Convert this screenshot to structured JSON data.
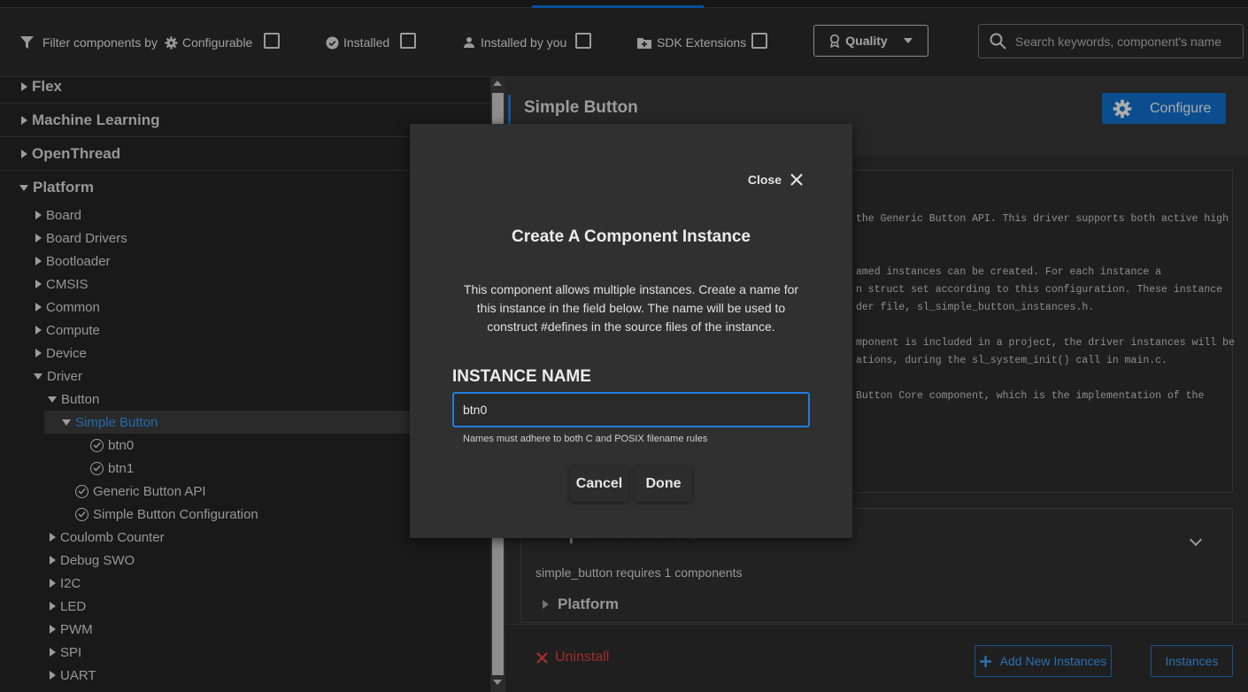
{
  "filters": {
    "label": "Filter components by",
    "configurable": "Configurable",
    "installed": "Installed",
    "installed_by_you": "Installed by you",
    "sdk_extensions": "SDK Extensions",
    "quality": "Quality"
  },
  "search": {
    "placeholder": "Search keywords, component's name"
  },
  "tree": {
    "categories": [
      "Flex",
      "Machine Learning",
      "OpenThread",
      "Platform"
    ],
    "platform_children": [
      "Board",
      "Board Drivers",
      "Bootloader",
      "CMSIS",
      "Common",
      "Compute",
      "Device",
      "Driver"
    ],
    "driver_child": "Button",
    "selected": "Simple Button",
    "instances": [
      "btn0",
      "btn1"
    ],
    "button_items": [
      "Generic Button API",
      "Simple Button Configuration"
    ],
    "driver_rest": [
      "Coulomb Counter",
      "Debug SWO",
      "I2C",
      "LED",
      "PWM",
      "SPI",
      "UART"
    ]
  },
  "detail": {
    "title": "Simple Button",
    "configure": "Configure",
    "desc_lines": [
      "the Generic Button API. This driver supports both active high",
      "amed instances can be created. For each instance a",
      "n struct set according to this configuration. These instance",
      "der file, sl_simple_button_instances.h.",
      "mponent is included in a project, the driver instances will be",
      "ations, during the sl_system_init() call in main.c.",
      "Button Core component, which is the implementation of the"
    ],
    "deps_heading": "Dependencies",
    "deps_sub": "simple_button requires 1 components",
    "deps_item": "Platform",
    "uninstall": "Uninstall",
    "add_instances": "Add New Instances",
    "instances": "Instances"
  },
  "modal": {
    "close": "Close",
    "title": "Create A Component Instance",
    "text": "This component allows multiple instances. Create a name for this instance in the field below. The name will be used to construct #defines in the source files of the instance.",
    "label": "INSTANCE NAME",
    "value": "btn0",
    "hint": "Names must adhere to both C and POSIX filename rules",
    "cancel": "Cancel",
    "done": "Done"
  },
  "colors": {
    "accent": "#1f7fdc",
    "danger": "#d13c3c",
    "selected_text": "#2b8fe6"
  }
}
